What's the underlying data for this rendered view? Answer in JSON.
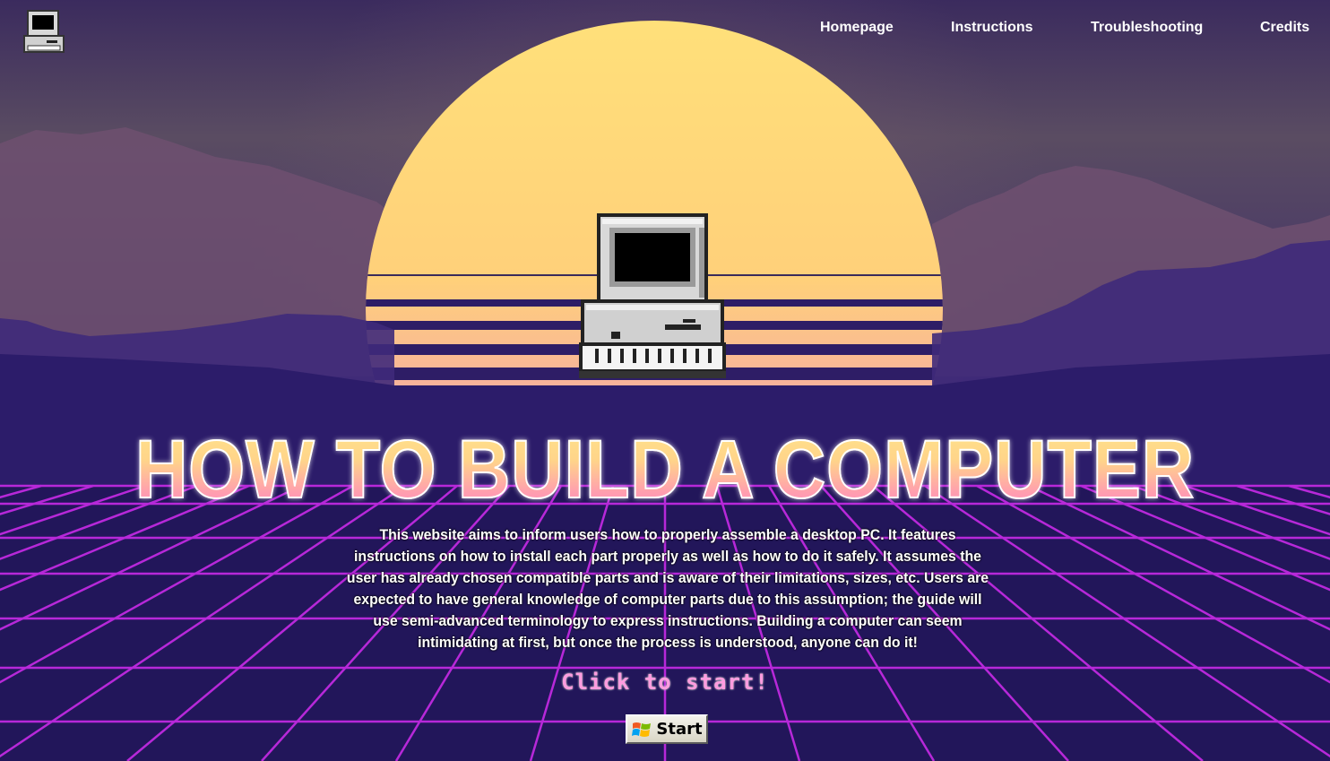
{
  "nav": {
    "logo_icon": "retro-computer-icon",
    "items": [
      {
        "label": "Homepage"
      },
      {
        "label": "Instructions"
      },
      {
        "label": "Troubleshooting"
      },
      {
        "label": "Credits"
      }
    ]
  },
  "hero": {
    "icon": "retro-computer-icon",
    "title": "HOW TO BUILD A COMPUTER",
    "description": "This website aims to inform users how to properly assemble a desktop PC. It features instructions on how to install each part properly as well as how to do it safely. It assumes the user has already chosen compatible parts and is aware of their limitations, sizes, etc. Users are expected to have general knowledge of computer parts due to this assumption; the guide will use semi-advanced terminology to express instructions. Building a computer can seem intimidating at first, but once the process is understood, anyone can do it!",
    "cta": "Click to start!",
    "start_button": {
      "label": "Start",
      "icon": "windows-flag-icon"
    }
  },
  "colors": {
    "sun_top": "#ffe17a",
    "sun_bottom": "#e86fc8",
    "grid": "#c020e0",
    "sky": "#3a2a5a",
    "mountains": "#6b4a7a",
    "cta": "#ff9ce0"
  }
}
